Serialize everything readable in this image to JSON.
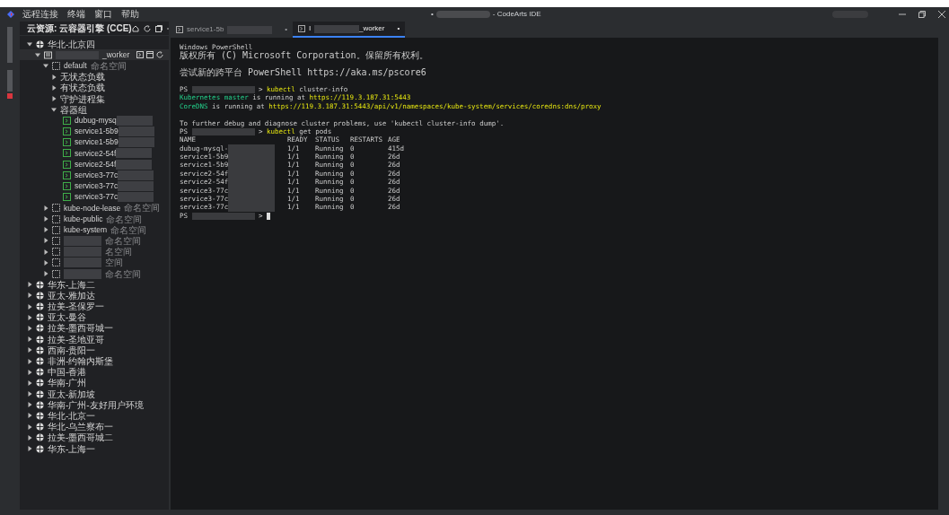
{
  "menu": [
    "远程连接",
    "终端",
    "窗口",
    "帮助"
  ],
  "window": {
    "title_prefix": "•",
    "title_redacted": true,
    "title": "- CodeArts IDE"
  },
  "sidebar": {
    "title": "云资源: 云容器引擎 (CCE)",
    "tree": [
      {
        "kind": "region",
        "label": "华北-北京四",
        "expanded": true,
        "children": [
          {
            "kind": "cluster",
            "label": "_worker",
            "redacted": true,
            "expanded": true,
            "children": [
              {
                "kind": "namespace",
                "label": "default",
                "tag": "命名空间",
                "expanded": true,
                "children": [
                  {
                    "kind": "group",
                    "label": "无状态负载",
                    "expanded": false
                  },
                  {
                    "kind": "group",
                    "label": "有状态负载",
                    "expanded": false
                  },
                  {
                    "kind": "group",
                    "label": "守护进程集",
                    "expanded": false
                  },
                  {
                    "kind": "group",
                    "label": "容器组",
                    "expanded": true,
                    "children": [
                      {
                        "kind": "pod",
                        "label": "dubug-mysq",
                        "redacted": true
                      },
                      {
                        "kind": "pod",
                        "label": "service1-5b9",
                        "redacted": true
                      },
                      {
                        "kind": "pod",
                        "label": "service1-5b9",
                        "redacted": true
                      },
                      {
                        "kind": "pod",
                        "label": "service2-54f",
                        "redacted": true
                      },
                      {
                        "kind": "pod",
                        "label": "service2-54f",
                        "redacted": true
                      },
                      {
                        "kind": "pod",
                        "label": "service3-77c",
                        "redacted": true
                      },
                      {
                        "kind": "pod",
                        "label": "service3-77c",
                        "redacted": true
                      },
                      {
                        "kind": "pod",
                        "label": "service3-77c",
                        "redacted": true
                      }
                    ]
                  }
                ]
              },
              {
                "kind": "namespace",
                "label": "kube-node-lease",
                "tag": "命名空间",
                "expanded": false
              },
              {
                "kind": "namespace",
                "label": "kube-public",
                "tag": "命名空间",
                "expanded": false
              },
              {
                "kind": "namespace",
                "label": "kube-system",
                "tag": "命名空间",
                "expanded": false
              },
              {
                "kind": "namespace",
                "redacted": true,
                "tag": "命名空间",
                "expanded": false
              },
              {
                "kind": "namespace",
                "redacted": true,
                "tag": "名空间",
                "expanded": false
              },
              {
                "kind": "namespace",
                "redacted": true,
                "tag": "空间",
                "expanded": false
              },
              {
                "kind": "namespace",
                "redacted": true,
                "tag": "命名空间",
                "expanded": false
              }
            ]
          }
        ]
      },
      {
        "kind": "region",
        "label": "华东-上海二",
        "expanded": false
      },
      {
        "kind": "region",
        "label": "亚太-雅加达",
        "expanded": false
      },
      {
        "kind": "region",
        "label": "拉美-圣保罗一",
        "expanded": false
      },
      {
        "kind": "region",
        "label": "亚太-曼谷",
        "expanded": false
      },
      {
        "kind": "region",
        "label": "拉美-墨西哥城一",
        "expanded": false
      },
      {
        "kind": "region",
        "label": "拉美-圣地亚哥",
        "expanded": false
      },
      {
        "kind": "region",
        "label": "西南-贵阳一",
        "expanded": false
      },
      {
        "kind": "region",
        "label": "非洲-约翰内斯堡",
        "expanded": false
      },
      {
        "kind": "region",
        "label": "中国-香港",
        "expanded": false
      },
      {
        "kind": "region",
        "label": "华南-广州",
        "expanded": false
      },
      {
        "kind": "region",
        "label": "亚太-新加坡",
        "expanded": false
      },
      {
        "kind": "region",
        "label": "华南-广州-友好用户环境",
        "expanded": false
      },
      {
        "kind": "region",
        "label": "华北-北京一",
        "expanded": false
      },
      {
        "kind": "region",
        "label": "华北-乌兰察布一",
        "expanded": false
      },
      {
        "kind": "region",
        "label": "拉美-墨西哥城二",
        "expanded": false
      },
      {
        "kind": "region",
        "label": "华东-上海一",
        "expanded": false
      }
    ]
  },
  "tabs": [
    {
      "before": "service1-5b",
      "selected": false,
      "dot": "•"
    },
    {
      "before": "l",
      "after": "_worker",
      "selected": true,
      "dot": "•"
    }
  ],
  "terminal": {
    "blocks": [
      [
        [
          {
            "kind": "plain",
            "text": "Windows PowerShell"
          }
        ],
        [
          {
            "kind": "plain",
            "text": "版权所有 (C) Microsoft Corporation。保留所有权利。"
          }
        ]
      ],
      [
        [
          {
            "kind": "plain",
            "text": "尝试新的跨平台 PowerShell https://aka.ms/pscore6"
          }
        ]
      ],
      [
        [
          {
            "kind": "plain",
            "text": "PS"
          },
          {
            "kind": "redacted"
          },
          {
            "kind": "plain",
            "text": ">"
          },
          {
            "kind": "command",
            "text": "kubectl"
          },
          {
            "kind": "plain",
            "text": "cluster-info"
          }
        ],
        [
          {
            "kind": "green",
            "text": "Kubernetes master"
          },
          {
            "kind": "plain",
            "text": "is running at"
          },
          {
            "kind": "link",
            "text": "https://119.3.187.31:5443"
          }
        ],
        [
          {
            "kind": "green",
            "text": "CoreDNS"
          },
          {
            "kind": "plain",
            "text": "is running at"
          },
          {
            "kind": "link",
            "text": "https://119.3.187.31:5443/api/v1/namespaces/kube-system/services/coredns:dns/proxy"
          }
        ]
      ],
      [
        [
          {
            "kind": "plain",
            "text": "To further debug and diagnose cluster problems, use 'kubectl cluster-info dump'."
          }
        ],
        [
          {
            "kind": "plain",
            "text": "PS"
          },
          {
            "kind": "redacted"
          },
          {
            "kind": "plain",
            "text": ">"
          },
          {
            "kind": "command",
            "text": "kubectl"
          },
          {
            "kind": "plain",
            "text": "get pods"
          }
        ]
      ]
    ],
    "pods": {
      "columns": [
        "NAME",
        "READY",
        "STATUS",
        "RESTARTS",
        "AGE"
      ],
      "rows": [
        [
          "dubug-mysql-",
          "1/1",
          "Running",
          "0",
          "415d"
        ],
        [
          "service1-5b9",
          "1/1",
          "Running",
          "0",
          "26d"
        ],
        [
          "service1-5b9",
          "1/1",
          "Running",
          "0",
          "26d"
        ],
        [
          "service2-54f",
          "1/1",
          "Running",
          "0",
          "26d"
        ],
        [
          "service2-54f",
          "1/1",
          "Running",
          "0",
          "26d"
        ],
        [
          "service3-77c",
          "1/1",
          "Running",
          "0",
          "26d"
        ],
        [
          "service3-77c",
          "1/1",
          "Running",
          "0",
          "26d"
        ],
        [
          "service3-77c",
          "1/1",
          "Running",
          "0",
          "26d"
        ]
      ]
    },
    "prompt": [
      {
        "kind": "plain",
        "text": "PS"
      },
      {
        "kind": "redacted"
      },
      {
        "kind": "plain",
        "text": ">"
      }
    ]
  }
}
